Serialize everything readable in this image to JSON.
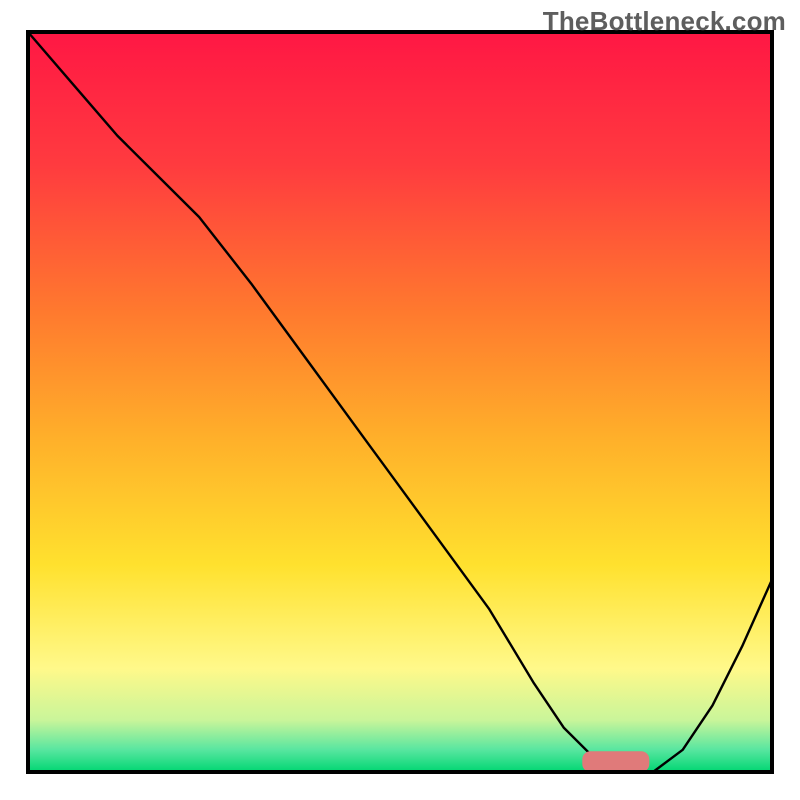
{
  "watermark": {
    "text": "TheBottleneck.com"
  },
  "chart_data": {
    "type": "line",
    "title": "",
    "xlabel": "",
    "ylabel": "",
    "xlim": [
      0,
      100
    ],
    "ylim": [
      0,
      100
    ],
    "grid": false,
    "background_gradient": {
      "direction": "vertical",
      "stops": [
        {
          "pos": 0.0,
          "color": "#ff1744"
        },
        {
          "pos": 0.18,
          "color": "#ff3b3f"
        },
        {
          "pos": 0.38,
          "color": "#ff7a2e"
        },
        {
          "pos": 0.55,
          "color": "#ffb02a"
        },
        {
          "pos": 0.72,
          "color": "#ffe12e"
        },
        {
          "pos": 0.86,
          "color": "#fff98a"
        },
        {
          "pos": 0.93,
          "color": "#c9f59a"
        },
        {
          "pos": 0.97,
          "color": "#58e6a0"
        },
        {
          "pos": 1.0,
          "color": "#00d672"
        }
      ]
    },
    "series": [
      {
        "name": "bottleneck-curve",
        "type": "line",
        "color": "#000000",
        "width": 2.4,
        "x": [
          0,
          6,
          12,
          18,
          23,
          30,
          38,
          46,
          54,
          62,
          68,
          72,
          76,
          80,
          84,
          88,
          92,
          96,
          100
        ],
        "y": [
          100,
          93,
          86,
          80,
          75,
          66,
          55,
          44,
          33,
          22,
          12,
          6,
          2,
          0,
          0,
          3,
          9,
          17,
          26
        ]
      }
    ],
    "marker": {
      "name": "optimal-zone-marker",
      "color": "#e07a7a",
      "x_center": 79,
      "x_halfwidth": 4.5,
      "y": 1.4,
      "thickness": 2.8
    }
  }
}
